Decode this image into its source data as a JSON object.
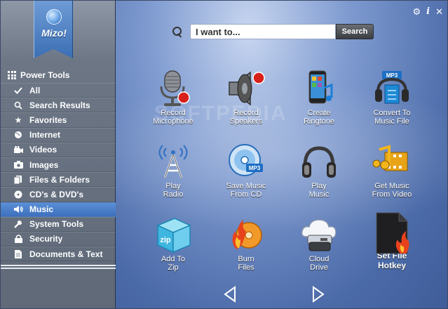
{
  "app": {
    "logo_text": "Mizo!"
  },
  "sidebar": {
    "header": "Power Tools",
    "items": [
      {
        "label": "All",
        "icon": "check-icon"
      },
      {
        "label": "Search Results",
        "icon": "search-icon"
      },
      {
        "label": "Favorites",
        "icon": "star-icon"
      },
      {
        "label": "Internet",
        "icon": "globe-icon"
      },
      {
        "label": "Videos",
        "icon": "video-camera-icon"
      },
      {
        "label": "Images",
        "icon": "camera-icon"
      },
      {
        "label": "Files & Folders",
        "icon": "files-icon"
      },
      {
        "label": "CD's & DVD's",
        "icon": "disc-icon"
      },
      {
        "label": "Music",
        "icon": "speaker-icon",
        "active": true
      },
      {
        "label": "System Tools",
        "icon": "wrench-icon"
      },
      {
        "label": "Security",
        "icon": "lock-icon"
      },
      {
        "label": "Documents & Text",
        "icon": "document-icon"
      }
    ]
  },
  "toolbar": {
    "settings_icon": "gear-icon",
    "info_icon": "info-icon"
  },
  "search": {
    "placeholder": "I want to...",
    "value": "",
    "button_label": "Search"
  },
  "watermark": "SOFTPEDIA",
  "tiles": [
    {
      "line1": "Record",
      "line2": "Microphone",
      "icon": "microphone-icon"
    },
    {
      "line1": "Record",
      "line2": "Speakers",
      "icon": "speaker-icon"
    },
    {
      "line1": "Create",
      "line2": "Ringtone",
      "icon": "phone-icon"
    },
    {
      "line1": "Convert To",
      "line2": "Music File",
      "icon": "mp3-convert-icon"
    },
    {
      "line1": "Play",
      "line2": "Radio",
      "icon": "radio-tower-icon"
    },
    {
      "line1": "Save Music",
      "line2": "From CD",
      "icon": "cd-mp3-icon"
    },
    {
      "line1": "Play",
      "line2": "Music",
      "icon": "headphones-icon"
    },
    {
      "line1": "Get Music",
      "line2": "From Video",
      "icon": "music-film-icon"
    },
    {
      "line1": "Add To",
      "line2": "Zip",
      "icon": "zip-box-icon"
    },
    {
      "line1": "Burn",
      "line2": "Files",
      "icon": "burn-disc-icon"
    },
    {
      "line1": "Cloud",
      "line2": "Drive",
      "icon": "cloud-drive-icon"
    },
    {
      "line1": "Set File",
      "line2": "Hotkey",
      "icon": "file-hotkey-icon",
      "big": true
    }
  ],
  "pager": {
    "prev_icon": "prev-arrow-icon",
    "next_icon": "next-arrow-icon"
  },
  "colors": {
    "active_item": "#3d70bd",
    "accent_red": "#d8201a"
  }
}
